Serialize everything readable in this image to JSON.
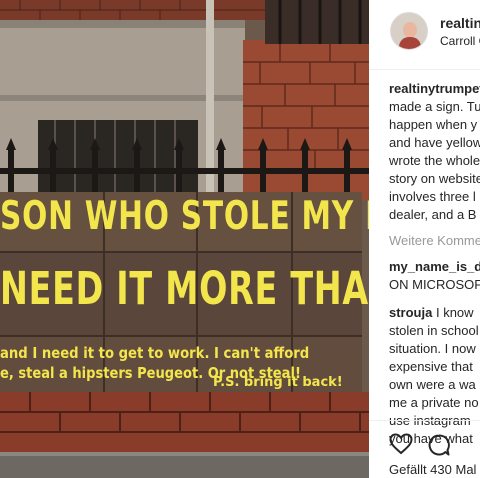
{
  "post": {
    "username": "realtinytrumpet",
    "location": "Carroll Gardens",
    "sign": {
      "line1": "SON WHO STOLE MY BIKE",
      "line2": "NEED IT MORE THAN ME",
      "line3": "and I need it to get to work. I can't afford",
      "line4": "e, steal a hipsters Peugeot. Or not steal!",
      "line5": "P.S. bring it back!"
    },
    "caption": {
      "username": "realtinytrumpet",
      "lines": [
        "made a sign. Tu",
        "happen when y",
        "and have yellow",
        "wrote the whole",
        "story on website",
        "involves three l",
        "dealer, and a B"
      ]
    },
    "more_comments_label": "Weitere Kommentare laden",
    "comment1": {
      "username": "my_name_is_d",
      "text": "ON MICROSOF"
    },
    "comment2": {
      "username": "strouja",
      "first": "I know",
      "lines": [
        "stolen in school",
        "situation. I now",
        "expensive that",
        "own were a wa",
        "me a private no",
        "use instagram",
        "you have what"
      ]
    },
    "likes_label": "Gefällt 430 Mal",
    "icons": {
      "like": "heart-icon",
      "comment": "comment-bubble-icon"
    },
    "colors": {
      "sign_text": "#f3e64d",
      "sign_board": "#5e4a3e",
      "text": "#262626",
      "muted": "#999999"
    }
  }
}
